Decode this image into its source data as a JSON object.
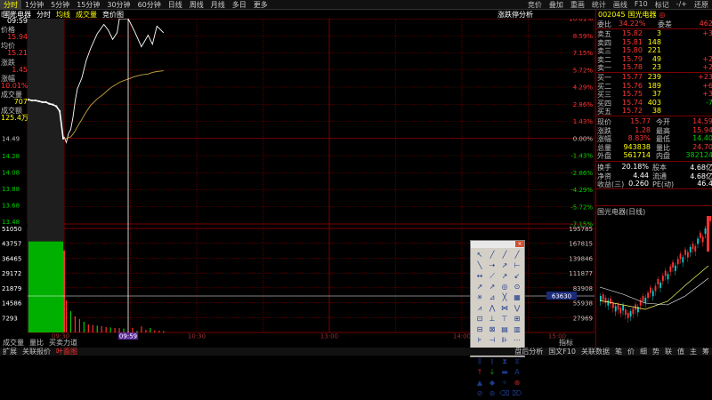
{
  "toolbar": {
    "periods": [
      "分时",
      "1分钟",
      "5分钟",
      "15分钟",
      "30分钟",
      "60分钟",
      "日线",
      "周线",
      "月线",
      "多日",
      "更多"
    ],
    "active_period": 0,
    "right_items": [
      "竞价",
      "叠加",
      "重画",
      "统计",
      "画线",
      "F10",
      "标记",
      "-/+",
      "还原"
    ]
  },
  "sub_bar": {
    "name": "国光电器",
    "label": "分时",
    "items": [
      "均线",
      "成交量",
      "竞价图"
    ]
  },
  "cursor_info": {
    "time_label": "时间",
    "time": "09:59",
    "price_label": "价格",
    "price": "15.94",
    "avg_label": "均价",
    "avg": "15.21",
    "change_label": "涨跌",
    "change": "1.45",
    "pct_label": "涨幅",
    "pct": "10.01%",
    "volume_label": "成交量",
    "volume": "707",
    "amount_label": "成交额",
    "amount": "125.4万"
  },
  "price_axis": {
    "left": [
      "14.49",
      "14.28",
      "14.08",
      "13.88",
      "13.68",
      "13.48"
    ],
    "right": [
      "10.01%",
      "8.59%",
      "7.15%",
      "5.72%",
      "4.29%",
      "2.86%",
      "1.43%",
      "0.00%",
      "-1.43%",
      "-2.86%",
      "-4.29%",
      "-5.72%",
      "-7.15%"
    ]
  },
  "volume_axis": {
    "left": [
      "51050",
      "43757",
      "36465",
      "29172",
      "21879",
      "14586",
      "7293"
    ],
    "right": [
      "195785",
      "167815",
      "139846",
      "111877",
      "83908",
      "55938",
      "27969"
    ],
    "cursor_value": "63630"
  },
  "time_axis": {
    "labels": [
      "09:30",
      "09:59",
      "10:30",
      "13:00",
      "14:00",
      "15:00"
    ],
    "active": "09:59"
  },
  "chart_caption": {
    "limit_up_label": "涨跌停分析"
  },
  "quote": {
    "code": "002045",
    "name": "国光电器",
    "weibi_label": "委比",
    "weibi": "34.22%",
    "weicha_label": "委差",
    "weicha": "462",
    "asks": [
      {
        "label": "卖五",
        "price": "15.82",
        "vol": "3",
        "chg": "+3"
      },
      {
        "label": "卖四",
        "price": "15.81",
        "vol": "148",
        "chg": ""
      },
      {
        "label": "卖三",
        "price": "15.80",
        "vol": "221",
        "chg": ""
      },
      {
        "label": "卖二",
        "price": "15.79",
        "vol": "49",
        "chg": "+2"
      },
      {
        "label": "卖一",
        "price": "15.78",
        "vol": "23",
        "chg": "+2"
      }
    ],
    "bids": [
      {
        "label": "买一",
        "price": "15.77",
        "vol": "239",
        "chg": "+23"
      },
      {
        "label": "买二",
        "price": "15.76",
        "vol": "189",
        "chg": "+6"
      },
      {
        "label": "买三",
        "price": "15.75",
        "vol": "37",
        "chg": "+3"
      },
      {
        "label": "买四",
        "price": "15.74",
        "vol": "403",
        "chg": "-7"
      },
      {
        "label": "买五",
        "price": "15.72",
        "vol": "38",
        "chg": ""
      }
    ],
    "stats": [
      {
        "l1": "现价",
        "v1": "15.77",
        "l2": "今开",
        "v2": "14.59"
      },
      {
        "l1": "涨跌",
        "v1": "1.28",
        "l2": "最高",
        "v2": "15.94"
      },
      {
        "l1": "涨幅",
        "v1": "8.83%",
        "l2": "最低",
        "v2": "14.40"
      },
      {
        "l1": "总量",
        "v1": "943838",
        "l2": "量比",
        "v2": "24.70"
      },
      {
        "l1": "外盘",
        "v1": "561714",
        "l2": "内盘",
        "v2": "382124"
      }
    ],
    "stats2": [
      {
        "l1": "换手",
        "v1": "20.18%",
        "l2": "股本",
        "v2": "4.68亿"
      },
      {
        "l1": "净资",
        "v1": "4.44",
        "l2": "流通",
        "v2": "4.68亿"
      },
      {
        "l1": "收益(三)",
        "v1": "0.260",
        "l2": "PE(动)",
        "v2": "46.4"
      }
    ],
    "mini_chart_label": "国光电器(日线)"
  },
  "bottom_bar": {
    "items": [
      "成交量",
      "量比",
      "买卖力道"
    ],
    "right": "指标"
  },
  "bottom_tabs": {
    "items": [
      "扩展",
      "关联报价",
      "叶面图"
    ],
    "active": 2,
    "right_items": [
      "盘后分析",
      "国文F10",
      "关联数据",
      "笔",
      "价",
      "细",
      "势",
      "联",
      "值",
      "主",
      "筹"
    ]
  },
  "chart_data": {
    "type": "line",
    "title": "",
    "xlabel": "",
    "ylabel": "",
    "ylim": [
      13.68,
      15.94
    ],
    "prev_close": 14.49,
    "x": [
      "09:25",
      "09:30",
      "09:31",
      "09:32",
      "09:33",
      "09:34",
      "09:35",
      "09:36",
      "09:38",
      "09:40",
      "09:42",
      "09:45",
      "09:48",
      "09:50",
      "09:52",
      "09:54",
      "09:55",
      "09:57",
      "09:59",
      "10:02",
      "10:05",
      "10:08",
      "10:10",
      "10:12",
      "10:15"
    ],
    "series": [
      {
        "values": [
          14.49,
          14.51,
          14.44,
          14.55,
          14.6,
          14.74,
          14.94,
          15.09,
          15.22,
          15.43,
          15.58,
          15.76,
          15.87,
          15.8,
          15.69,
          15.77,
          15.94,
          15.94,
          15.94,
          15.78,
          15.6,
          15.74,
          15.63,
          15.85,
          15.77
        ]
      },
      {
        "values": [
          14.49,
          14.49,
          14.49,
          14.5,
          14.51,
          14.54,
          14.58,
          14.63,
          14.72,
          14.81,
          14.89,
          14.97,
          15.03,
          15.08,
          15.12,
          15.15,
          15.17,
          15.19,
          15.21,
          15.24,
          15.26,
          15.27,
          15.29,
          15.3,
          15.31
        ]
      }
    ],
    "auction": {
      "x": [
        "09:15",
        "09:16",
        "09:17",
        "09:18",
        "09:19",
        "09:20",
        "09:21",
        "09:22",
        "09:23",
        "09:24",
        "09:25"
      ],
      "values": [
        14.96,
        14.95,
        14.95,
        14.94,
        14.93,
        14.93,
        14.91,
        14.9,
        14.88,
        14.82,
        14.49
      ]
    },
    "volume": {
      "x": [
        "09:31",
        "09:33",
        "09:35",
        "09:37",
        "09:39",
        "09:41",
        "09:43",
        "09:45",
        "09:47",
        "09:49",
        "09:51",
        "09:53",
        "09:55",
        "09:57",
        "09:59",
        "10:01",
        "10:03",
        "10:05",
        "10:07",
        "10:09",
        "10:11",
        "10:13",
        "10:15"
      ],
      "values": [
        18000,
        12000,
        9000,
        7500,
        6000,
        4500,
        4200,
        3800,
        3500,
        3000,
        2800,
        2500,
        2400,
        2200,
        707,
        2600,
        900,
        3400,
        1500,
        2500,
        1200,
        1000,
        800
      ]
    }
  }
}
